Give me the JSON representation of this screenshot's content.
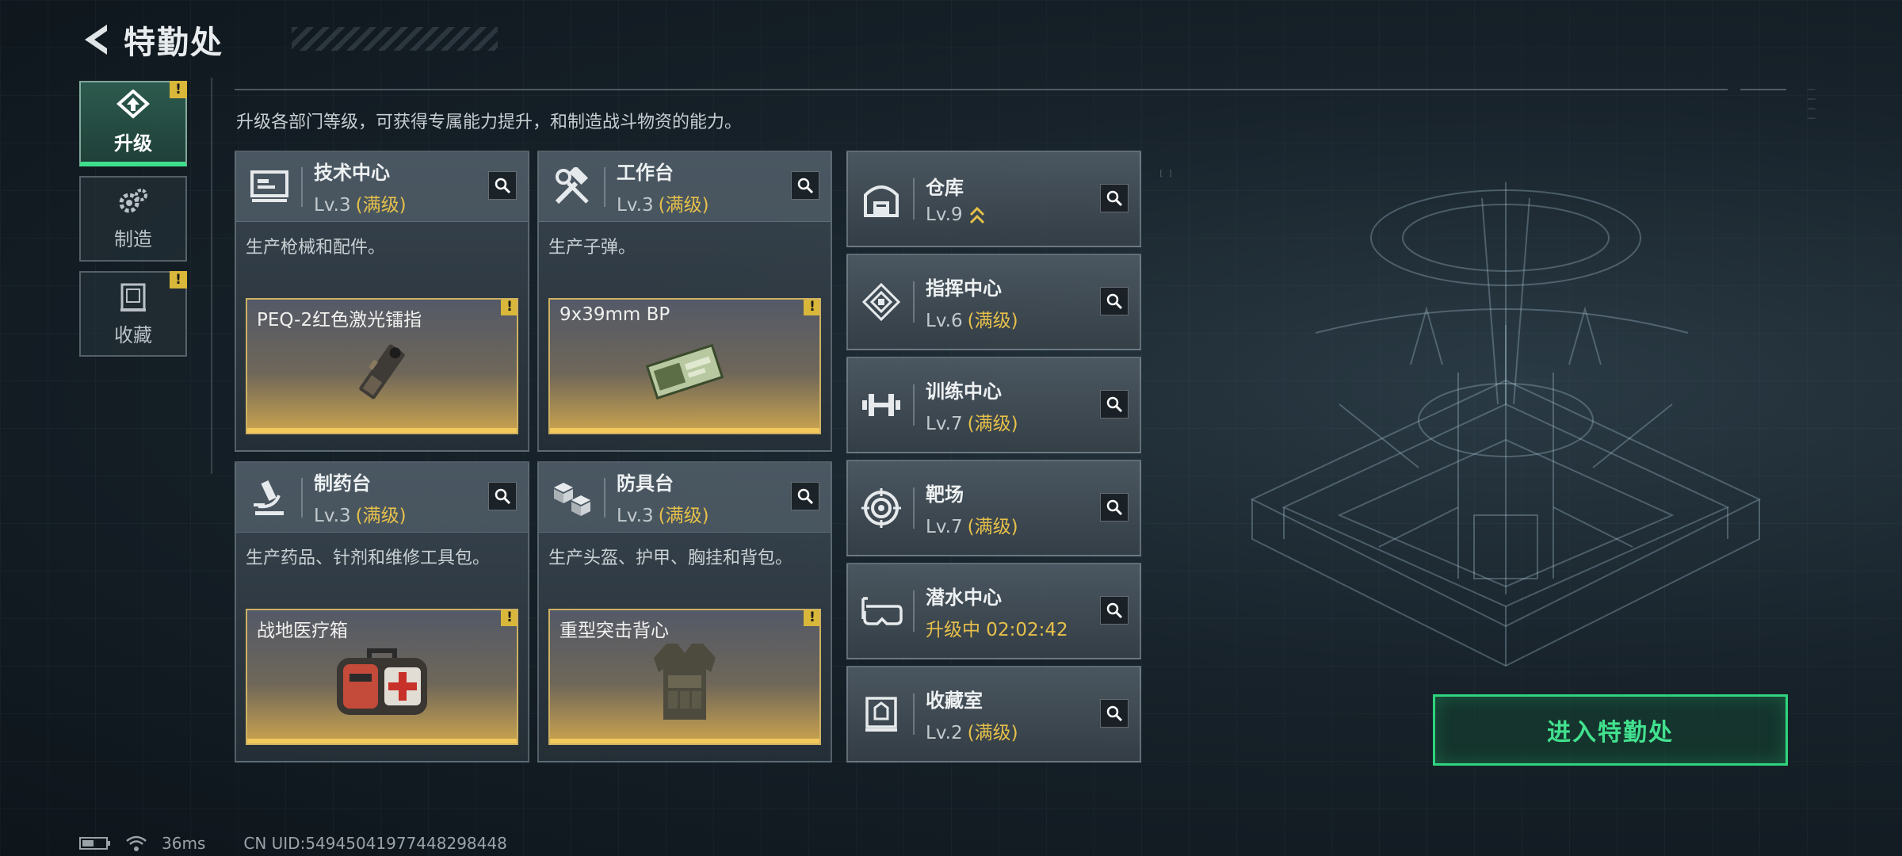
{
  "header": {
    "title": "特勤处"
  },
  "sidebar": {
    "tabs": [
      {
        "label": "升级",
        "alert": "!"
      },
      {
        "label": "制造"
      },
      {
        "label": "收藏",
        "alert": "!"
      }
    ]
  },
  "description": "升级各部门等级，可获得专属能力提升，和制造战斗物资的能力。",
  "departments": [
    {
      "name": "技术中心",
      "level": "Lv.3",
      "status": "(满级)",
      "desc": "生产枪械和配件。",
      "item": "PEQ-2红色激光镭指",
      "alert": "!"
    },
    {
      "name": "工作台",
      "level": "Lv.3",
      "status": "(满级)",
      "desc": "生产子弹。",
      "item": "9x39mm BP",
      "alert": "!"
    },
    {
      "name": "制药台",
      "level": "Lv.3",
      "status": "(满级)",
      "desc": "生产药品、针剂和维修工具包。",
      "item": "战地医疗箱",
      "alert": "!"
    },
    {
      "name": "防具台",
      "level": "Lv.3",
      "status": "(满级)",
      "desc": "生产头盔、护甲、胸挂和背包。",
      "item": "重型突击背心",
      "alert": "!"
    }
  ],
  "facilities": [
    {
      "name": "仓库",
      "level": "Lv.9"
    },
    {
      "name": "指挥中心",
      "level": "Lv.6",
      "status": "(满级)"
    },
    {
      "name": "训练中心",
      "level": "Lv.7",
      "status": "(满级)"
    },
    {
      "name": "靶场",
      "level": "Lv.7",
      "status": "(满级)"
    },
    {
      "name": "潜水中心",
      "upgrading": "升级中 02:02:42"
    },
    {
      "name": "收藏室",
      "level": "Lv.2",
      "status": "(满级)"
    }
  ],
  "enter_button": "进入特勤处",
  "status_bar": {
    "ping": "36ms",
    "uid": "CN UID:54945041977448298448"
  },
  "colors": {
    "accent_green": "#2fd57e",
    "maxed_gold": "#e6c04a",
    "alert_yellow": "#d9b73a"
  }
}
